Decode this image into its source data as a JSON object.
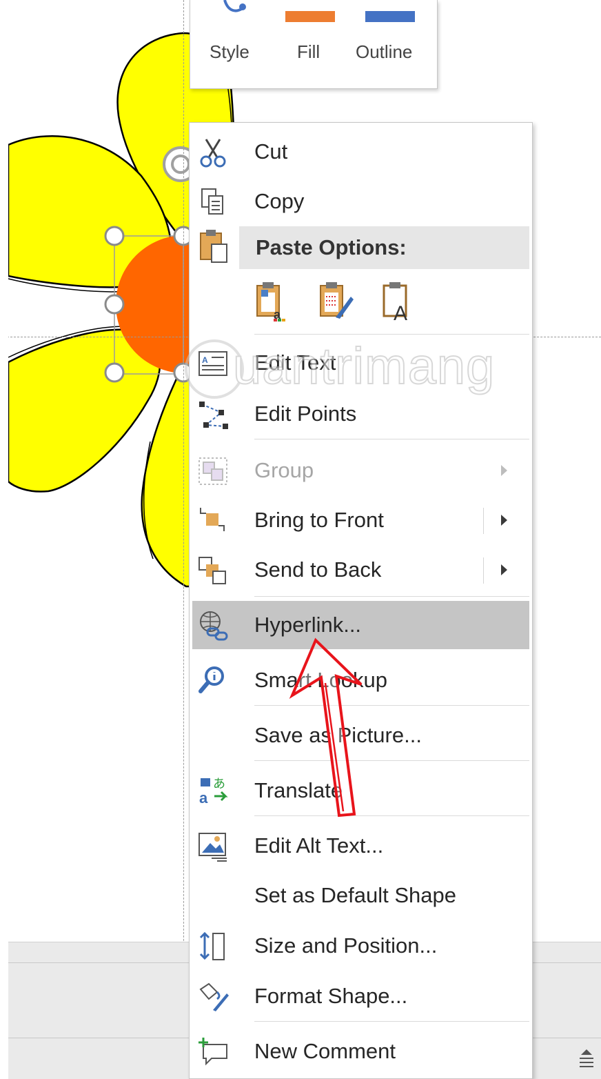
{
  "mini_toolbar": {
    "style_label": "Style",
    "fill_label": "Fill",
    "outline_label": "Outline",
    "fill_color": "#ED7D31",
    "outline_color": "#4472C4"
  },
  "menu": {
    "cut": "Cut",
    "copy": "Copy",
    "paste_options": "Paste Options:",
    "edit_text": "Edit Text",
    "edit_points": "Edit Points",
    "group": "Group",
    "bring_to_front": "Bring to Front",
    "send_to_back": "Send to Back",
    "hyperlink": "Hyperlink...",
    "smart_lookup": "Smart Lookup",
    "save_as_picture": "Save as Picture...",
    "translate": "Translate",
    "edit_alt_text": "Edit Alt Text...",
    "set_default_shape": "Set as Default Shape",
    "size_and_position": "Size and Position...",
    "format_shape": "Format Shape...",
    "new_comment": "New Comment"
  },
  "watermark": {
    "text": "uantrimang"
  },
  "colors": {
    "petal": "#FFFF00",
    "center": "#FF6600",
    "highlight": "#C5C5C5",
    "annotation_arrow": "#E8141B"
  }
}
